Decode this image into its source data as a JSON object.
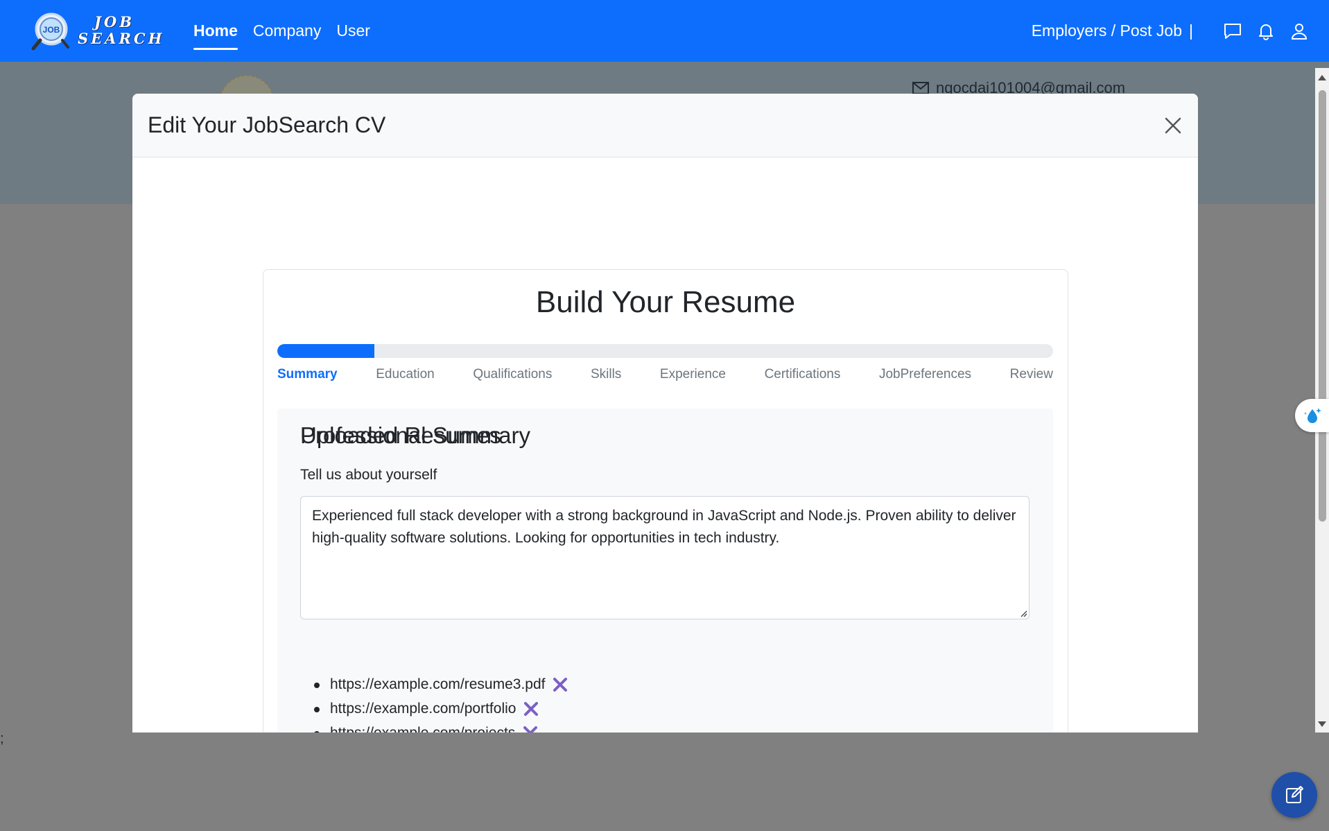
{
  "navbar": {
    "logo_lines": [
      "JOB",
      "SEARCH"
    ],
    "logo_badge": "JOB",
    "links": [
      {
        "label": "Home",
        "active": true
      },
      {
        "label": "Company",
        "active": false
      },
      {
        "label": "User",
        "active": false
      }
    ],
    "employers_label": "Employers / Post Job",
    "separator": "|",
    "icons": [
      "chat-icon",
      "bell-icon",
      "user-icon"
    ],
    "color": "#0d6efd"
  },
  "background": {
    "email": "ngocdai101004@gmail.com",
    "stray_text": ";"
  },
  "modal": {
    "title": "Edit Your JobSearch CV",
    "close_icon": "close-icon"
  },
  "resume_builder": {
    "title": "Build Your Resume",
    "progress_fraction": 0.125,
    "steps": [
      {
        "label": "Summary",
        "active": true
      },
      {
        "label": "Education",
        "active": false
      },
      {
        "label": "Qualifications",
        "active": false
      },
      {
        "label": "Skills",
        "active": false
      },
      {
        "label": "Experience",
        "active": false
      },
      {
        "label": "Certifications",
        "active": false
      },
      {
        "label": "JobPreferences",
        "active": false
      },
      {
        "label": "Review",
        "active": false
      }
    ],
    "summary": {
      "heading": "Professional Summary",
      "prompt": "Tell us about yourself",
      "value": "Experienced full stack developer with a strong background in JavaScript and Node.js. Proven ability to deliver high-quality software solutions. Looking for opportunities in tech industry."
    },
    "uploaded": {
      "heading": "Uploaded Resumes",
      "items": [
        "https://example.com/resume3.pdf",
        "https://example.com/portfolio",
        "https://example.com/projects"
      ],
      "remove_icon": "remove-x-icon",
      "remove_color": "#7b5fc7"
    }
  },
  "accent": "#0d6efd"
}
